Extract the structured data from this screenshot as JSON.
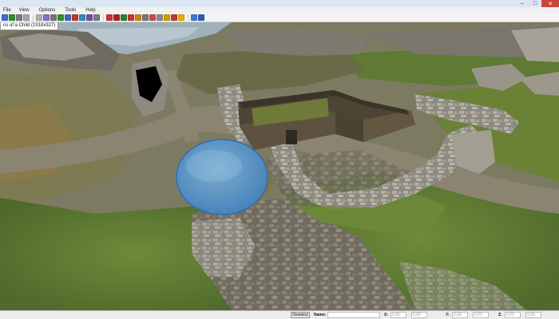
{
  "window": {
    "title": "",
    "minimize_glyph": "–",
    "maximize_glyph": "□",
    "close_glyph": "✕"
  },
  "menu": {
    "file": "File",
    "view": "View",
    "options": "Options",
    "tools": "Tools",
    "help": "Help"
  },
  "tab": {
    "label": "ns of a Child (1918x927)"
  },
  "toolbar": {
    "colors": [
      "#3a6fd1",
      "#2f8f2f",
      "#7a7a7a",
      "#9aa6b8",
      "#b0b0b0",
      "#8a6cc6",
      "#777777",
      "#2f8f2f",
      "#3f63c7",
      "#c0392b",
      "#2b8fc0",
      "#7a4aa8",
      "#7a7a7a",
      "#cc3333",
      "#aa2222",
      "#2e7d32",
      "#cc3333",
      "#cc8800",
      "#777777",
      "#c94a4a",
      "#8a8a8a",
      "#d0a000",
      "#c0392b",
      "#e0b000",
      "#3a7bd5",
      "#2a5fb0"
    ]
  },
  "status": {
    "deselect_label": "Deselect",
    "name_label": "Name:",
    "x_label": "X:",
    "y_label": "Y:",
    "z_label": "Z:",
    "x_value": "0.00",
    "x2_value": "0.00",
    "y_value": "0.00",
    "y2_value": "0.00",
    "z_value": "0.00",
    "z2_value": "0.00"
  }
}
